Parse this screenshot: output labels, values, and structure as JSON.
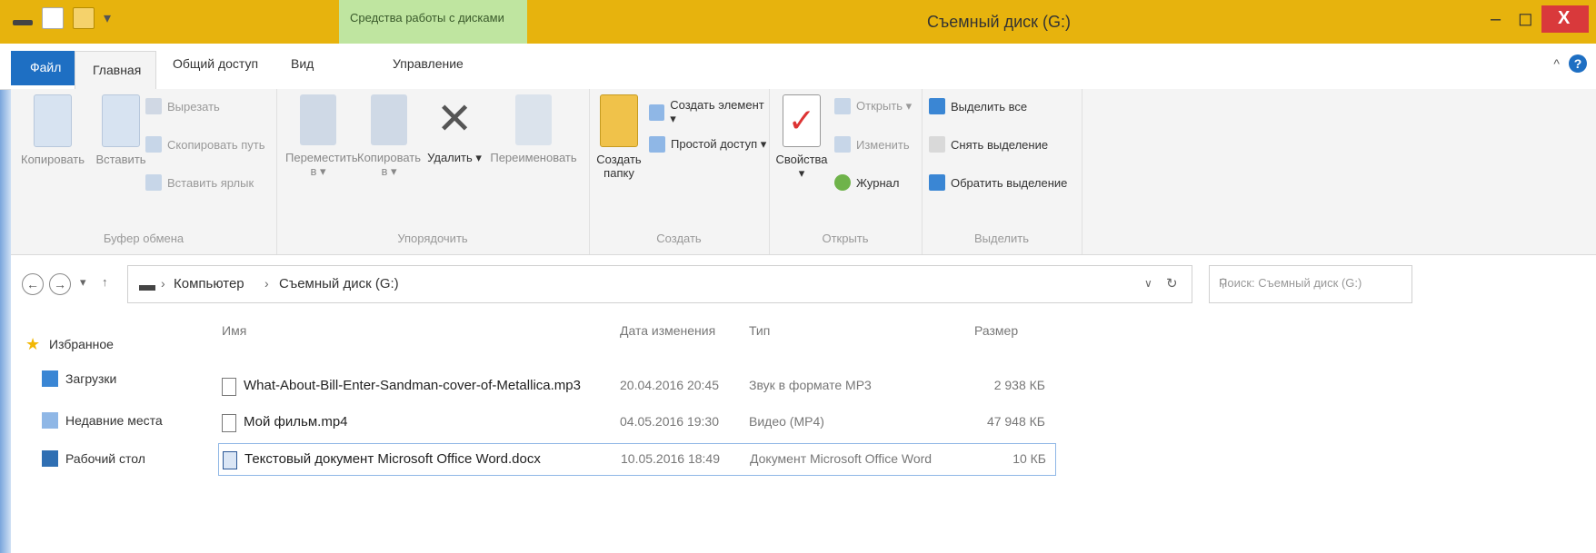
{
  "window": {
    "title": "Съемный диск (G:)",
    "tools_tab": "Средства работы с дисками",
    "accent": "#e7b30d",
    "close_color": "#d9393b",
    "file_tab_color": "#1e6fc3",
    "tools_tab_color": "#bfe5a0",
    "minimize": "–",
    "maximize": "◻",
    "close": "X",
    "help": "?"
  },
  "tabs": [
    "Файл",
    "Главная",
    "Общий доступ",
    "Вид",
    "Управление"
  ],
  "ribbon": {
    "clipboard": {
      "label": "Буфер обмена",
      "copy": "Копировать",
      "paste": "Вставить",
      "cut": "Вырезать",
      "copy_path": "Скопировать путь",
      "paste_shortcut": "Вставить ярлык"
    },
    "organize": {
      "label": "Упорядочить",
      "move_to": "Переместить в ▾",
      "copy_to": "Копировать в ▾",
      "delete": "Удалить ▾",
      "rename": "Переименовать"
    },
    "new": {
      "label": "Создать",
      "new_folder": "Создать папку",
      "new_item": "Создать элемент ▾",
      "easy_access": "Простой доступ ▾"
    },
    "open": {
      "label": "Открыть",
      "properties": "Свойства ▾",
      "open": "Открыть ▾",
      "edit": "Изменить",
      "history": "Журнал"
    },
    "select": {
      "label": "Выделить",
      "select_all": "Выделить все",
      "select_none": "Снять выделение",
      "invert": "Обратить выделение"
    }
  },
  "address": {
    "segments": [
      "Компьютер",
      "Съемный диск (G:)"
    ],
    "search_placeholder": "Поиск: Съемный диск (G:)"
  },
  "navpane": {
    "items": [
      {
        "label": "Избранное",
        "icon": "star-icon"
      },
      {
        "label": "Загрузки",
        "icon": "downloads-icon"
      },
      {
        "label": "Недавние места",
        "icon": "recent-places-icon"
      },
      {
        "label": "Рабочий стол",
        "icon": "desktop-icon"
      }
    ]
  },
  "filelist": {
    "columns": [
      "Имя",
      "Дата изменения",
      "Тип",
      "Размер"
    ],
    "rows": [
      {
        "name": "What-About-Bill-Enter-Sandman-cover-of-Metallica.mp3",
        "date": "20.04.2016 20:45",
        "type": "Звук в формате MP3",
        "size": "2 938 КБ"
      },
      {
        "name": "Мой фильм.mp4",
        "date": "04.05.2016 19:30",
        "type": "Видео (MP4)",
        "size": "47 948 КБ"
      },
      {
        "name": "Текстовый документ Microsoft Office Word.docx",
        "date": "10.05.2016 18:49",
        "type": "Документ Microsoft Office Word",
        "size": "10 КБ"
      }
    ]
  }
}
